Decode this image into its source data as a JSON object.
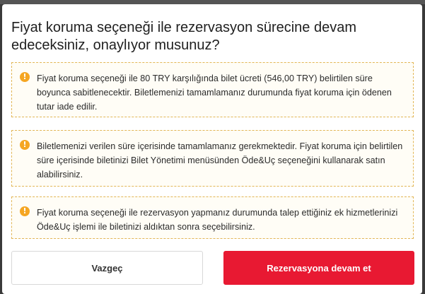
{
  "modal": {
    "title": "Fiyat koruma seçeneği ile rezervasyon sürecine devam edeceksiniz, onaylıyor musunuz?",
    "notices": [
      {
        "icon": "info-icon",
        "text": "Fiyat koruma seçeneği ile 80 TRY karşılığında bilet ücreti (546,00 TRY) belirtilen süre boyunca sabitlenecektir. Biletlemenizi tamamlamanız durumunda fiyat koruma için ödenen tutar iade edilir."
      },
      {
        "icon": "info-icon",
        "text": "Biletlemenizi verilen süre içerisinde tamamlamanız gerekmektedir. Fiyat koruma için belirtilen süre içerisinde biletinizi Bilet Yönetimi menüsünden Öde&Uç seçeneğini kullanarak satın alabilirsiniz."
      },
      {
        "icon": "info-icon",
        "text": "Fiyat koruma seçeneği ile rezervasyon yapmanız durumunda talep ettiğiniz ek hizmetlerinizi Öde&Uç işlemi ile biletinizi aldıktan sonra seçebilirsiniz."
      }
    ],
    "buttons": {
      "cancel_label": "Vazgeç",
      "confirm_label": "Rezervasyona devam et"
    }
  },
  "colors": {
    "confirm": "#e81932",
    "notice_border": "#e2b656",
    "info_icon": "#f5a623"
  }
}
